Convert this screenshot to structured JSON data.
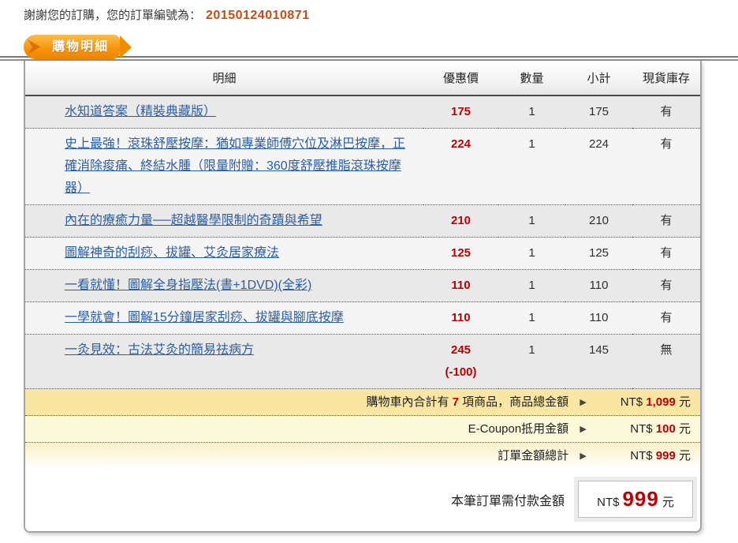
{
  "page": {
    "thank_you_prefix": "謝謝您的訂購，您的訂單編號為：",
    "order_number": "20150124010871"
  },
  "tab": {
    "label": "購物明細"
  },
  "icons": {
    "arrow": "▶"
  },
  "colors": {
    "tab_orange": "#f79210",
    "link_blue": "#2b5ea7",
    "price_red": "#c00000",
    "order_number_orange": "#cc4a14",
    "summary_yellow": "#f8e6a2",
    "summary_pale_yellow": "#fcf8da"
  },
  "table": {
    "headers": [
      "明細",
      "優惠價",
      "數量",
      "小計",
      "現貨庫存"
    ],
    "rows": [
      {
        "title": "水知道答案（精裝典藏版）",
        "price": "175",
        "qty": "1",
        "subtotal": "175",
        "stock": "有"
      },
      {
        "title": "史上最強！滾珠舒壓按摩：猶如專業師傅穴位及淋巴按摩，正確消除痠痛、終結水腫（限量附贈：360度舒壓推脂滾珠按摩器）",
        "price": "224",
        "qty": "1",
        "subtotal": "224",
        "stock": "有"
      },
      {
        "title": "內在的療癒力量──超越醫學限制的奇蹟與希望",
        "price": "210",
        "qty": "1",
        "subtotal": "210",
        "stock": "有"
      },
      {
        "title": "圖解神奇的刮痧、拔罐、艾灸居家療法",
        "price": "125",
        "qty": "1",
        "subtotal": "125",
        "stock": "有"
      },
      {
        "title": "一看就懂！圖解全身指壓法(書+1DVD)(全彩)",
        "price": "110",
        "qty": "1",
        "subtotal": "110",
        "stock": "有"
      },
      {
        "title": "一學就會！圖解15分鐘居家刮痧、拔罐與腳底按摩",
        "price": "110",
        "qty": "1",
        "subtotal": "110",
        "stock": "有"
      },
      {
        "title": "一灸見效：古法艾灸的簡易祛病方",
        "price": "245",
        "discount": "(-100)",
        "qty": "1",
        "subtotal": "145",
        "stock": "無"
      }
    ]
  },
  "summary": {
    "items_total": {
      "label_prefix": "購物車內合計有",
      "count": "7",
      "label_suffix": "項商品，商品總金額",
      "currency": "NT$",
      "amount": "1,099",
      "unit": "元"
    },
    "coupon": {
      "label": "E-Coupon抵用金額",
      "currency": "NT$",
      "amount": "100",
      "unit": "元"
    },
    "order_total": {
      "label": "訂單金額總計",
      "currency": "NT$",
      "amount": "999",
      "unit": "元"
    },
    "payment": {
      "label": "本筆訂單需付款金額",
      "currency": "NT$",
      "amount": "999",
      "unit": "元"
    }
  }
}
